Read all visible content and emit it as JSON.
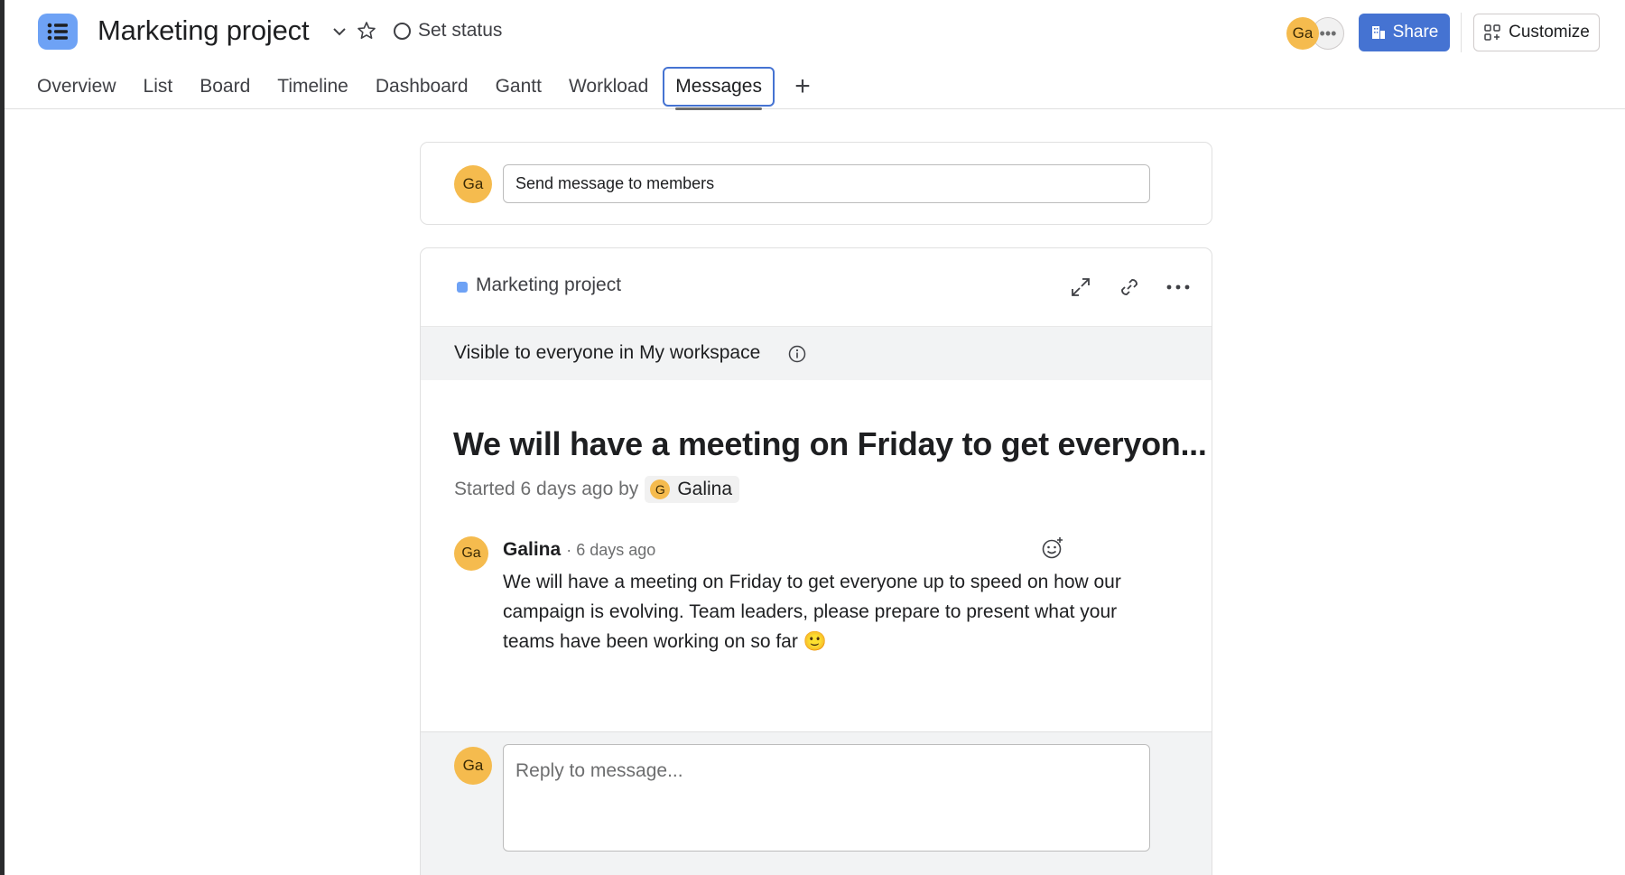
{
  "header": {
    "project_title": "Marketing project",
    "set_status_label": "Set status",
    "avatar_initials": "Ga",
    "share_label": "Share",
    "customize_label": "Customize"
  },
  "tabs": [
    {
      "label": "Overview",
      "active": false
    },
    {
      "label": "List",
      "active": false
    },
    {
      "label": "Board",
      "active": false
    },
    {
      "label": "Timeline",
      "active": false
    },
    {
      "label": "Dashboard",
      "active": false
    },
    {
      "label": "Gantt",
      "active": false
    },
    {
      "label": "Workload",
      "active": false
    },
    {
      "label": "Messages",
      "active": true
    }
  ],
  "composer": {
    "avatar_initials": "Ga",
    "value": "Send message to members"
  },
  "message": {
    "project_label": "Marketing project",
    "visibility": "Visible to everyone in My workspace",
    "title": "We will have a meeting on Friday to get everyon...",
    "started_prefix": "Started 6 days ago by",
    "author_initial": "G",
    "author_name": "Galina",
    "comment": {
      "avatar_initials": "Ga",
      "author": "Galina",
      "time": "· 6 days ago",
      "body": "We will have a meeting on Friday to get everyone up to speed on how our campaign is evolving. Team leaders, please prepare to present what your teams have been working on so far 🙂"
    }
  },
  "reply": {
    "avatar_initials": "Ga",
    "placeholder": "Reply to message..."
  },
  "colors": {
    "accent": "#4573d2",
    "avatar": "#f5bb4e",
    "project_dot": "#6ea2f5"
  }
}
